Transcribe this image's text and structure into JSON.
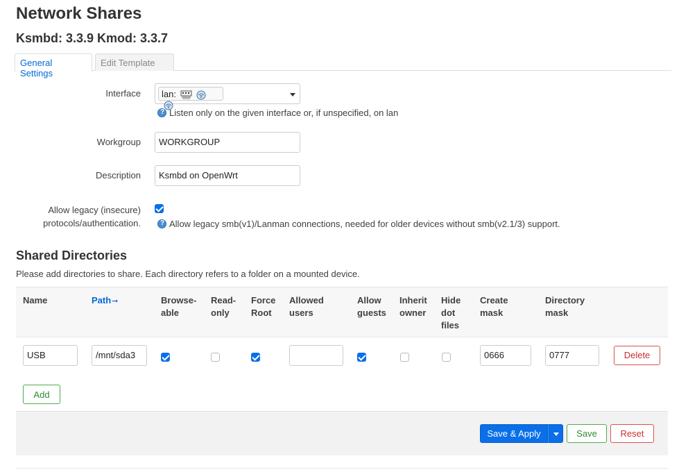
{
  "page": {
    "title": "Network Shares",
    "subtitle": "Ksmbd: 3.3.9 Kmod: 3.3.7"
  },
  "tabs": [
    {
      "label": "General Settings",
      "active": true
    },
    {
      "label": "Edit Template",
      "active": false
    }
  ],
  "general": {
    "interface": {
      "label": "Interface",
      "value": "lan:",
      "icons": [
        "ethernet-switch-icon",
        "wifi-icon",
        "wifi-icon"
      ],
      "hint": "Listen only on the given interface or, if unspecified, on lan"
    },
    "workgroup": {
      "label": "Workgroup",
      "value": "WORKGROUP"
    },
    "description": {
      "label": "Description",
      "value": "Ksmbd on OpenWrt"
    },
    "legacy": {
      "label_line1": "Allow legacy (insecure)",
      "label_line2": "protocols/authentication.",
      "checked": true,
      "hint": "Allow legacy smb(v1)/Lanman connections, needed for older devices without smb(v2.1/3) support."
    }
  },
  "shared": {
    "title": "Shared Directories",
    "description": "Please add directories to share. Each directory refers to a folder on a mounted device.",
    "columns": {
      "name": "Name",
      "path": "Path",
      "browseable_1": "Browse-",
      "browseable_2": "able",
      "readonly_1": "Read-",
      "readonly_2": "only",
      "forceroot_1": "Force",
      "forceroot_2": "Root",
      "allowedusers_1": "Allowed",
      "allowedusers_2": "users",
      "allowguests_1": "Allow",
      "allowguests_2": "guests",
      "inherit_1": "Inherit",
      "inherit_2": "owner",
      "hidedot_1": "Hide",
      "hidedot_2": "dot",
      "hidedot_3": "files",
      "createmask_1": "Create",
      "createmask_2": "mask",
      "dirmask_1": "Directory",
      "dirmask_2": "mask"
    },
    "rows": [
      {
        "name": "USB",
        "path": "/mnt/sda3",
        "browseable": true,
        "read_only": false,
        "force_root": true,
        "allowed_users": "",
        "allow_guests": true,
        "inherit_owner": false,
        "hide_dot_files": false,
        "create_mask": "0666",
        "directory_mask": "0777"
      }
    ],
    "delete_label": "Delete",
    "add_label": "Add"
  },
  "footer": {
    "save_apply_label": "Save & Apply",
    "save_label": "Save",
    "reset_label": "Reset"
  },
  "colors": {
    "primary": "#0a6fe8",
    "link": "#0069d6",
    "success": "#4cae4c",
    "danger": "#d9534f"
  }
}
